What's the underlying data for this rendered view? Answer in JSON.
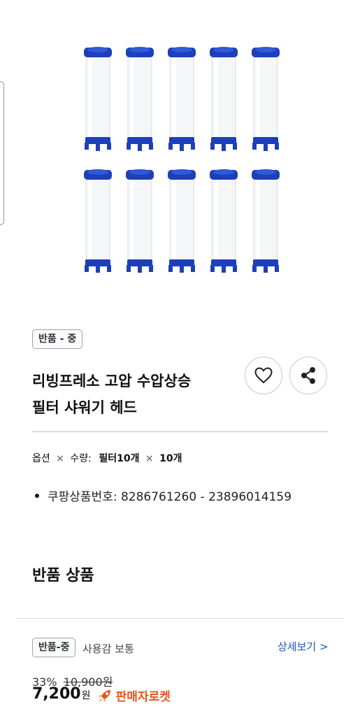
{
  "product": {
    "condition_badge": "반품 - 중",
    "title_line1": "리빙프레소 고압 수압상승",
    "title_line2": "필터 샤워기 헤드",
    "option_prefix": "옵션",
    "option_times": "×",
    "option_qty_label": "수량:",
    "option_value": "필터10개",
    "option_times2": "×",
    "option_qty": "10개",
    "product_number": "쿠팡상품번호: 8286761260 - 23896014159",
    "filter_count": 10
  },
  "return_section": {
    "title": "반품 상품",
    "badge": "반품-중",
    "usage": "사용감 보통",
    "detail_link": "상세보기 >",
    "discount": "33%",
    "original_price": "10,900원",
    "price": "7,200",
    "won": "원",
    "seller_rocket": "판매자로켓"
  },
  "colors": {
    "accent_link": "#1a56c4",
    "rocket": "#e8541a",
    "filter_cap": "#1d3fb8"
  },
  "icons": [
    "heart-icon",
    "share-icon",
    "rocket-icon"
  ]
}
